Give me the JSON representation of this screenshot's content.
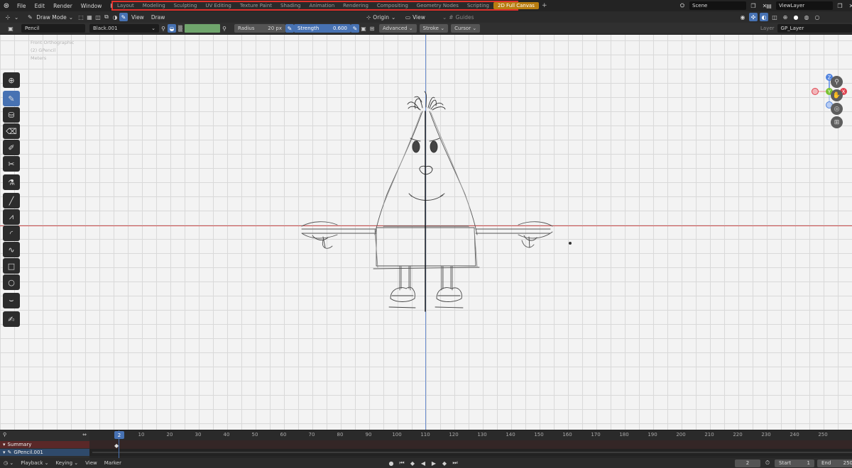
{
  "menu": [
    "File",
    "Edit",
    "Render",
    "Window",
    "Help"
  ],
  "workspaces": {
    "tabs": [
      "Layout",
      "Modeling",
      "Sculpting",
      "UV Editing",
      "Texture Paint",
      "Shading",
      "Animation",
      "Rendering",
      "Compositing",
      "Geometry Nodes",
      "Scripting",
      "2D Full Canvas"
    ],
    "active": "2D Full Canvas",
    "add": "+"
  },
  "scene": "Scene",
  "view_layer": "ViewLayer",
  "header": {
    "mode": "Draw Mode",
    "view": "View",
    "draw": "Draw",
    "origin": "Origin",
    "view2": "View",
    "guides": "Guides"
  },
  "tool_settings": {
    "brush": "Pencil",
    "material": "Black.001",
    "radius_label": "Radius",
    "radius_value": "20 px",
    "strength_label": "Strength",
    "strength_value": "0.600",
    "advanced": "Advanced",
    "stroke": "Stroke",
    "cursor": "Cursor",
    "layer_label": "Layer",
    "layer_value": "GP_Layer",
    "color": "#6fa56c"
  },
  "viewport_info": [
    "Front Orthographic",
    "(2) GPencil",
    "Meters"
  ],
  "gizmo": {
    "z": "Z",
    "y": "Y",
    "x": "X"
  },
  "timeline": {
    "ticks": [
      2,
      10,
      20,
      30,
      40,
      50,
      60,
      70,
      80,
      90,
      100,
      110,
      120,
      130,
      140,
      150,
      160,
      170,
      180,
      190,
      200,
      210,
      220,
      230,
      240,
      250
    ],
    "current_frame": "2",
    "summary_label": "Summary",
    "object_label": "GPencil.001"
  },
  "playback": {
    "playback": "Playback",
    "keying": "Keying",
    "view": "View",
    "marker": "Marker",
    "frame": "2",
    "start_label": "Start",
    "start": "1",
    "end_label": "End",
    "end": "250"
  }
}
